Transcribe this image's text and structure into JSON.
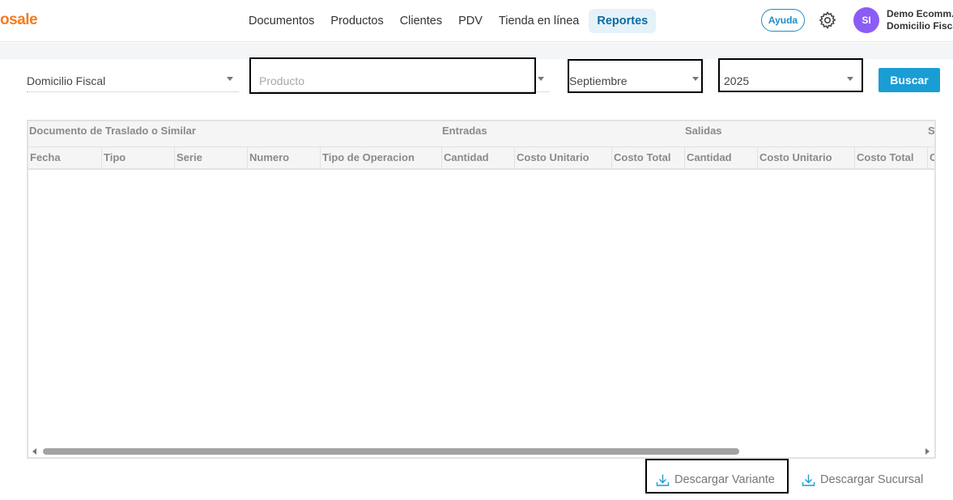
{
  "app": {
    "logo_text": "osale"
  },
  "nav": {
    "items": [
      {
        "label": "Documentos"
      },
      {
        "label": "Productos"
      },
      {
        "label": "Clientes"
      },
      {
        "label": "PDV"
      },
      {
        "label": "Tienda en línea"
      },
      {
        "label": "Reportes",
        "active": true
      }
    ]
  },
  "header": {
    "help_label": "Ayuda",
    "settings_icon": "gear-icon",
    "avatar_initials": "SI",
    "avatar_color": "#8b5cf6",
    "user_name": "Demo Ecomm.",
    "user_branch": "Domicilio Fisca"
  },
  "filters": {
    "branch": {
      "value": "Domicilio Fiscal"
    },
    "product": {
      "placeholder": "Producto",
      "value": ""
    },
    "month": {
      "value": "Septiembre"
    },
    "year": {
      "value": "2025"
    },
    "search_label": "Buscar"
  },
  "table": {
    "group_headers": [
      "Documento de Traslado o Similar",
      "Entradas",
      "Salidas",
      "S"
    ],
    "columns": [
      "Fecha",
      "Tipo",
      "Serie",
      "Numero",
      "Tipo de Operacion",
      "Cantidad",
      "Costo Unitario",
      "Costo Total",
      "Cantidad",
      "Costo Unitario",
      "Costo Total",
      "C"
    ],
    "rows": []
  },
  "actions": {
    "download_variant": "Descargar Variante",
    "download_branch": "Descargar Sucursal",
    "download_icon": "download-icon"
  },
  "colors": {
    "accent": "#1a9dd4",
    "brand": "#f47b20",
    "active_nav_bg": "#e5f2f8"
  }
}
